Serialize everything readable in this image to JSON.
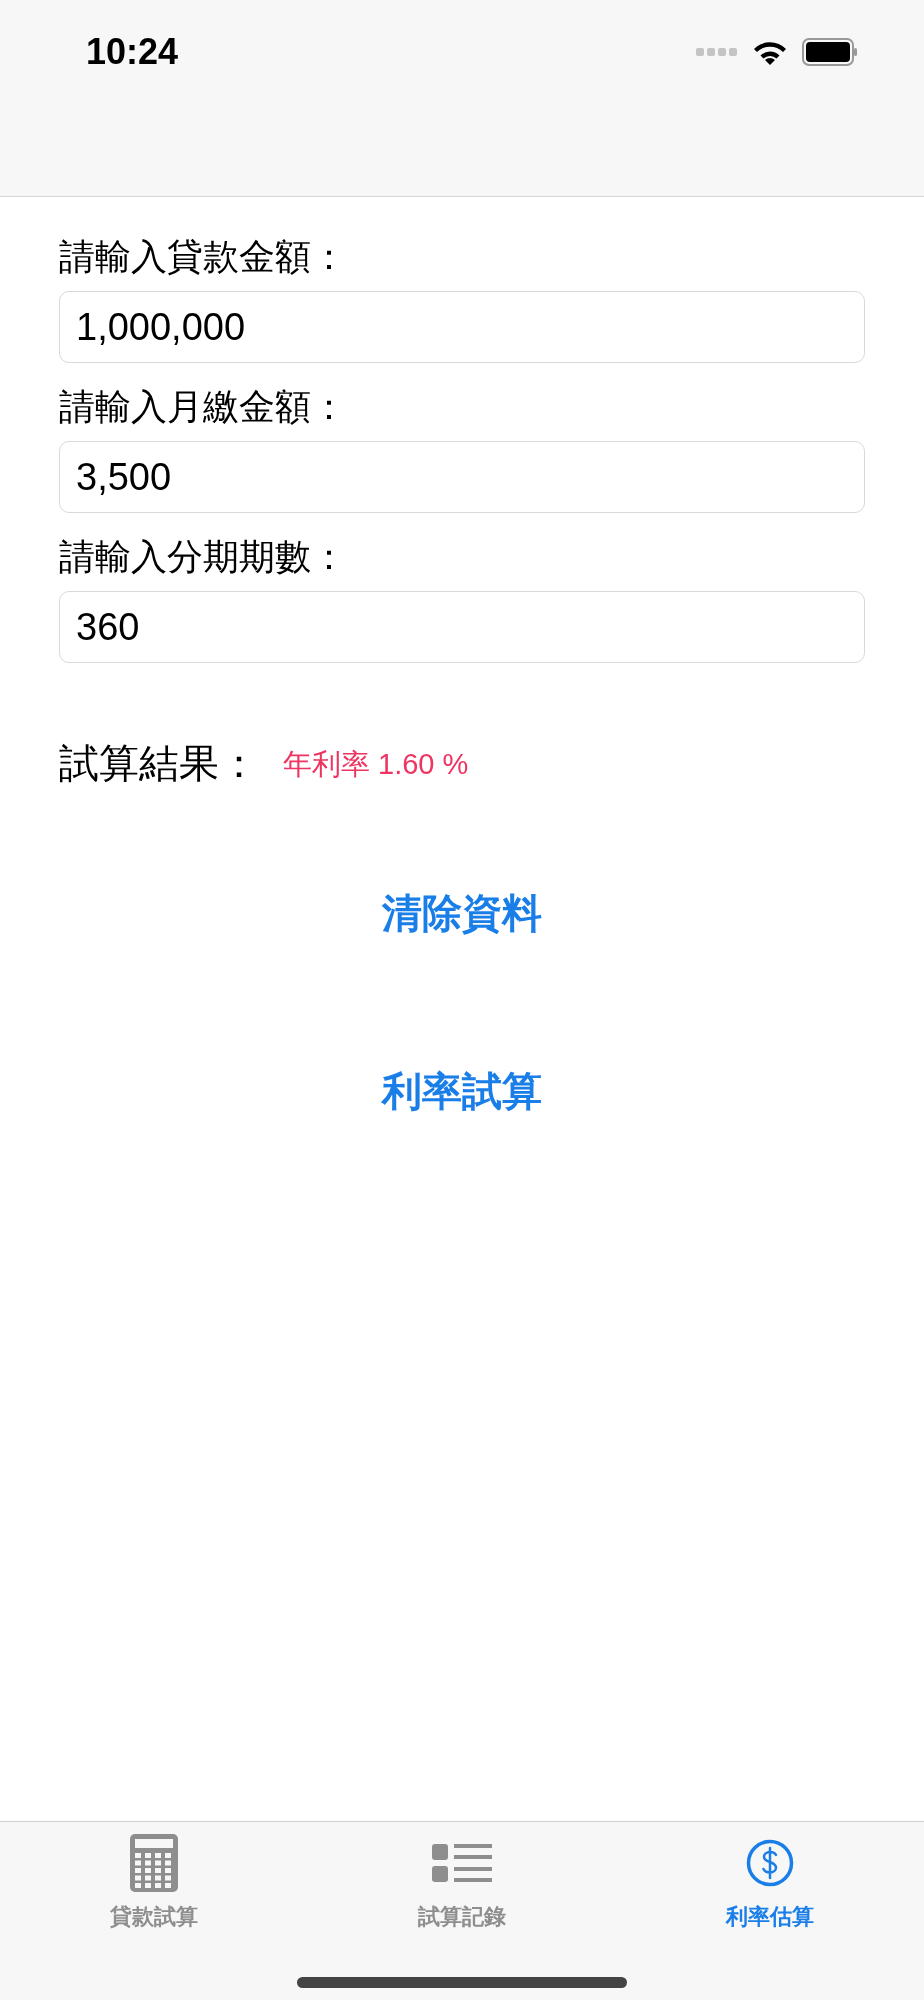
{
  "status_bar": {
    "time": "10:24"
  },
  "fields": [
    {
      "label": "請輸入貸款金額：",
      "value": "1,000,000"
    },
    {
      "label": "請輸入月繳金額：",
      "value": "3,500"
    },
    {
      "label": "請輸入分期期數：",
      "value": "360"
    }
  ],
  "result": {
    "label": "試算結果：",
    "value": "年利率 1.60 %"
  },
  "buttons": [
    "清除資料",
    "利率試算"
  ],
  "tabs": [
    {
      "label": "貸款試算",
      "selected": false
    },
    {
      "label": "試算記錄",
      "selected": false
    },
    {
      "label": "利率估算",
      "selected": true
    }
  ]
}
